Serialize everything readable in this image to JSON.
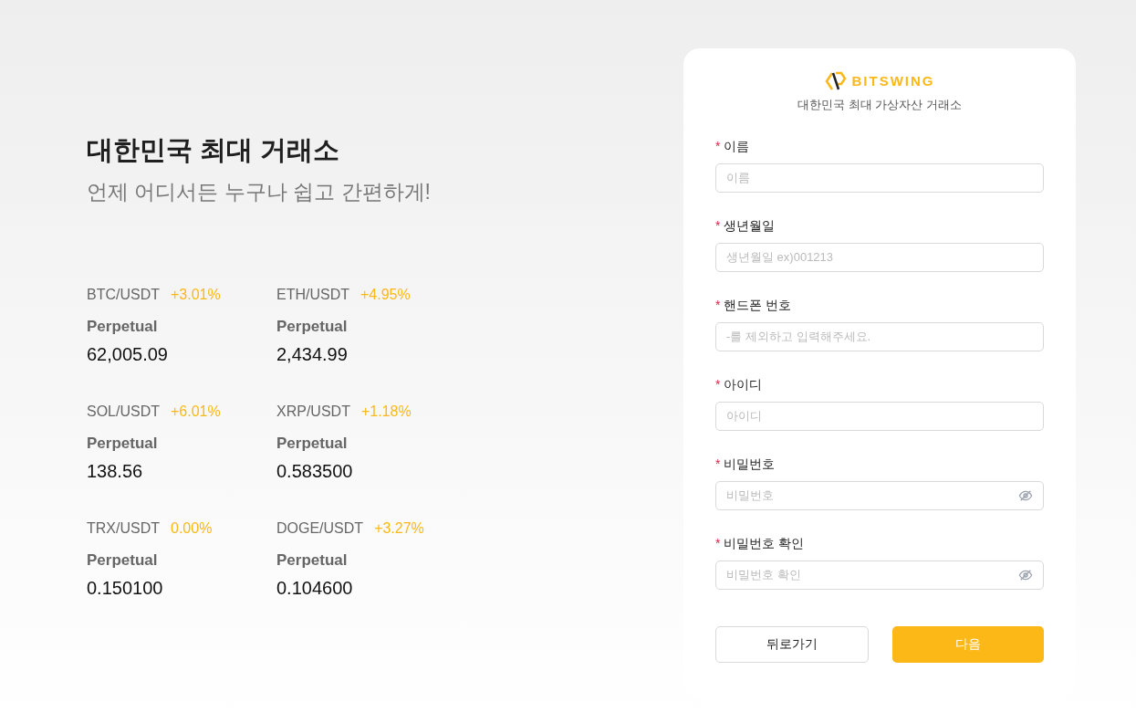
{
  "hero": {
    "title": "대한민국 최대 거래소",
    "subtitle": "언제 어디서든 누구나 쉽고 간편하게!"
  },
  "markets": [
    {
      "pair": "BTC/USDT",
      "change": "+3.01%",
      "type": "Perpetual",
      "price": "62,005.09"
    },
    {
      "pair": "ETH/USDT",
      "change": "+4.95%",
      "type": "Perpetual",
      "price": "2,434.99"
    },
    {
      "pair": "SOL/USDT",
      "change": "+6.01%",
      "type": "Perpetual",
      "price": "138.56"
    },
    {
      "pair": "XRP/USDT",
      "change": "+1.18%",
      "type": "Perpetual",
      "price": "0.583500"
    },
    {
      "pair": "TRX/USDT",
      "change": "0.00%",
      "type": "Perpetual",
      "price": "0.150100"
    },
    {
      "pair": "DOGE/USDT",
      "change": "+3.27%",
      "type": "Perpetual",
      "price": "0.104600"
    }
  ],
  "form": {
    "brand": "BITSWING",
    "tagline": "대한민국 최대 가상자산 거래소",
    "fields": [
      {
        "kind": "text",
        "required_mark": "*",
        "label": "이름",
        "placeholder": "이름"
      },
      {
        "kind": "text",
        "required_mark": "*",
        "label": "생년월일",
        "placeholder": "생년월일 ex)001213"
      },
      {
        "kind": "text",
        "required_mark": "*",
        "label": "핸드폰 번호",
        "placeholder": "-를 제외하고 입력해주세요."
      },
      {
        "kind": "text",
        "required_mark": "*",
        "label": "아이디",
        "placeholder": "아이디"
      },
      {
        "kind": "password",
        "required_mark": "*",
        "label": "비밀번호",
        "placeholder": "비밀번호"
      },
      {
        "kind": "password",
        "required_mark": "*",
        "label": "비밀번호 확인",
        "placeholder": "비밀번호 확인"
      }
    ],
    "buttons": [
      {
        "kind": "secondary",
        "label": "뒤로가기"
      },
      {
        "kind": "primary",
        "label": "다음"
      }
    ]
  }
}
